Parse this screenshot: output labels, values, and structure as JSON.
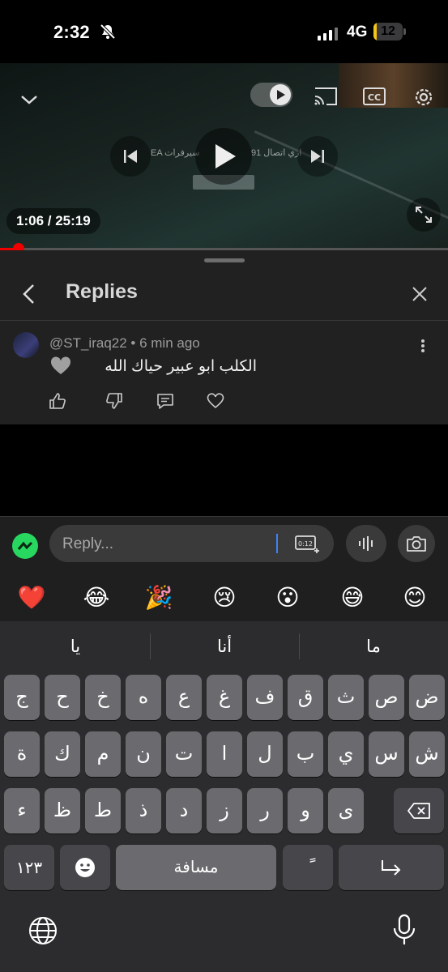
{
  "status_bar": {
    "time": "2:32",
    "network": "4G",
    "battery": "12",
    "battery_level": 0.12
  },
  "video": {
    "timecode": "1:06 / 25:19",
    "progress": 0.042,
    "overlay_left": "EA سيرفرات",
    "overlay_right": "91 اري اتصال"
  },
  "replies_panel": {
    "title": "Replies",
    "comment": {
      "meta": "@ST_iraq22 • 6 min ago",
      "text": "الكلب ابو عبير حياك الله"
    }
  },
  "input": {
    "placeholder": "Reply...",
    "timer_label": "0:12"
  },
  "emoji_bar": [
    "❤️",
    "😂",
    "🎉",
    "😢",
    "😮",
    "😅",
    "😊"
  ],
  "keyboard": {
    "suggestions": [
      "يا",
      "أنا",
      "ما"
    ],
    "row1": [
      "ض",
      "ص",
      "ث",
      "ق",
      "ف",
      "غ",
      "ع",
      "ه",
      "خ",
      "ح",
      "ج"
    ],
    "row2": [
      "ش",
      "س",
      "ي",
      "ب",
      "ل",
      "ا",
      "ت",
      "ن",
      "م",
      "ك",
      "ة"
    ],
    "row3": [
      "ء",
      "ظ",
      "ط",
      "ذ",
      "د",
      "ز",
      "ر",
      "و",
      "ى"
    ],
    "numbers_label": "١٢٣",
    "space_label": "مسافة",
    "diacritic_label": "ً"
  },
  "colors": {
    "accent_red": "#ee0000",
    "brand_green": "#27d760",
    "cursor_blue": "#3d82f6"
  }
}
